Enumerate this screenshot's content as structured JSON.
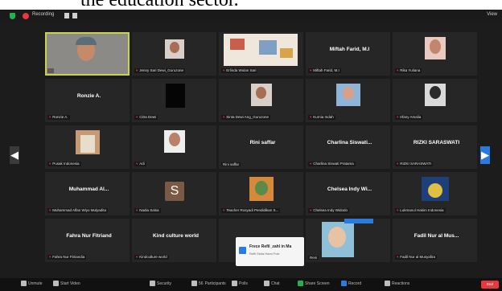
{
  "heading": {
    "text": "the education sector."
  },
  "topbar": {
    "recording": "Recording",
    "view": "View"
  },
  "nav": {
    "prev_arrow": "◀",
    "next_arrow": "▶"
  },
  "tiles": {
    "t0": {
      "label": ""
    },
    "t1": {
      "label": "Jenny Sari Dewi_Guruzone"
    },
    "t2": {
      "label": "Erlinda Wulan Sari"
    },
    "t3": {
      "name": "Miftah Farid, M.I",
      "label": "Miftah Farid, M.I"
    },
    "t4": {
      "label": "Rika Yuliana"
    },
    "t5": {
      "name": "Ronzie A.",
      "label": "Ronzie A."
    },
    "t6": {
      "label": "Citra Dewi"
    },
    "t7": {
      "label": "Sinta Dewi Ang_Guruzone"
    },
    "t8": {
      "label": "Kurnia Indah"
    },
    "t9": {
      "label": "Irfany Amalia"
    },
    "t10": {
      "label": "Pusak Indonesia"
    },
    "t11": {
      "label": "Adi"
    },
    "t12": {
      "name": "Rini saffar",
      "label": "Rini saffar"
    },
    "t13": {
      "name": "Charlina Siswati...",
      "label": "Charlina Siswati Pratama"
    },
    "t14": {
      "name": "RIZKI SARASWATI",
      "label": "RIZKI SARASWATI"
    },
    "t15": {
      "name": "Muhammad Al...",
      "label": "Muhammad Alfan Wiyo Mulyadita"
    },
    "t16": {
      "letter": "S",
      "label": "Nadia Salsa"
    },
    "t17": {
      "label": "Teacher Rosyadi Pendidikan S..."
    },
    "t18": {
      "name": "Chelsea Indy Wi...",
      "label": "Chelsea Indy Widodo"
    },
    "t19": {
      "label": "Lukmanul Hakim Indonesia"
    },
    "t20": {
      "name": "Fahra Nur Fitriand",
      "label": "Fahra Nur Fitriandia"
    },
    "t21": {
      "name": "Kind culture world",
      "label": "Kindculture world"
    },
    "t22": {
      "label": "Reni"
    },
    "t23": {
      "name": "Fadil Nur al Mus...",
      "label": "Fadil Nur al Musyafira"
    }
  },
  "popup": {
    "title": "Frece Refil_zahl in Ma",
    "subtitle": "Refil Sinta Hami Fole"
  },
  "toolbar": {
    "unmute": "Unmute",
    "start_video": "Start Video",
    "security": "Security",
    "participants": "Participants",
    "participants_count": "56",
    "polls": "Polls",
    "chat": "Chat",
    "share_screen": "Share Screen",
    "record": "Record",
    "reactions": "Reactions",
    "end": "End"
  }
}
